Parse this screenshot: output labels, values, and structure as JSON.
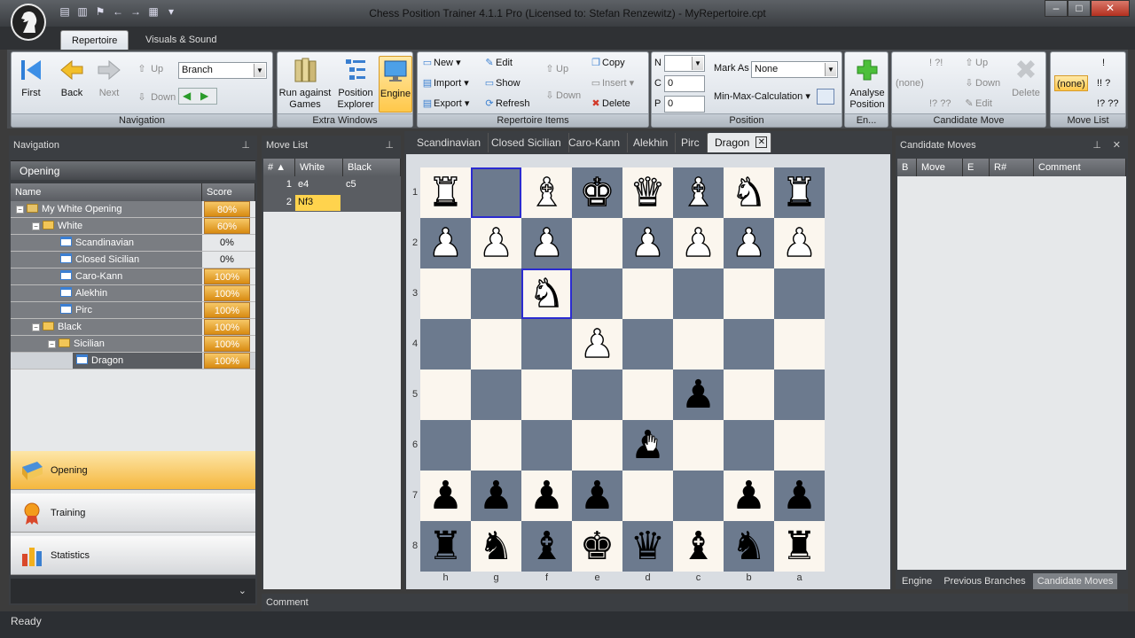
{
  "window": {
    "title": "Chess Position Trainer 4.1.1 Pro (Licensed to: Stefan Renzewitz) - MyRepertoire.cpt",
    "buttons": [
      "–",
      "□",
      "✕"
    ]
  },
  "ribbon_tabs": [
    "Repertoire",
    "Visuals & Sound"
  ],
  "ribbon": {
    "navigation": {
      "caption": "Navigation",
      "first": "First",
      "back": "Back",
      "next": "Next",
      "up": "Up",
      "down": "Down",
      "branch_value": "Branch"
    },
    "extra_windows": {
      "caption": "Extra Windows",
      "run_against_1": "Run against",
      "run_against_2": "Games",
      "position_1": "Position",
      "position_2": "Explorer",
      "engine": "Engine"
    },
    "repertoire_items": {
      "caption": "Repertoire Items",
      "new": "New",
      "import": "Import",
      "export": "Export",
      "edit": "Edit",
      "show": "Show",
      "refresh": "Refresh",
      "up": "Up",
      "down": "Down",
      "copy": "Copy",
      "insert": "Insert",
      "delete": "Delete"
    },
    "position": {
      "caption": "Position",
      "n_label": "N",
      "c_label": "C",
      "c_value": "0",
      "p_label": "P",
      "p_value": "0",
      "mark_as_label": "Mark As",
      "mark_as_value": "None",
      "minmax": "Min-Max-Calculation"
    },
    "engine_group": {
      "caption": "En...",
      "analyse_1": "Analyse",
      "analyse_2": "Position"
    },
    "candidate_move": {
      "caption": "Candidate Move",
      "none": "(none)",
      "up": "Up",
      "down": "Down",
      "edit": "Edit",
      "delete": "Delete",
      "marks_a": "! ?!",
      "marks_b": "!? ??"
    },
    "move_list": {
      "caption": "Move List",
      "none": "(none)",
      "marks_a": "!",
      "marks_b": "!! ?",
      "marks_c": "!? ??"
    }
  },
  "navigation_panel": {
    "title": "Navigation",
    "section": "Opening",
    "columns": [
      "Name",
      "Score"
    ],
    "rows": [
      {
        "name": "My White Opening",
        "score": "80%"
      },
      {
        "name": "White",
        "score": "60%"
      },
      {
        "name": "Scandinavian",
        "score": "0%"
      },
      {
        "name": "Closed Sicilian",
        "score": "0%"
      },
      {
        "name": "Caro-Kann",
        "score": "100%"
      },
      {
        "name": "Alekhin",
        "score": "100%"
      },
      {
        "name": "Pirc",
        "score": "100%"
      },
      {
        "name": "Black",
        "score": "100%"
      },
      {
        "name": "Sicilian",
        "score": "100%"
      },
      {
        "name": "Dragon",
        "score": "100%"
      }
    ],
    "buttons": [
      "Opening",
      "Training",
      "Statistics"
    ]
  },
  "move_list_panel": {
    "title": "Move List",
    "columns": [
      "#",
      "White",
      "Black"
    ],
    "moves": [
      {
        "n": "1",
        "white": "e4",
        "black": "c5"
      },
      {
        "n": "2",
        "white": "Nf3",
        "black": ""
      }
    ]
  },
  "board_tabs": [
    "Scandinavian",
    "Closed Sicilian",
    "Caro-Kann",
    "Alekhin",
    "Pirc",
    "Dragon"
  ],
  "board": {
    "ranks": [
      "1",
      "2",
      "3",
      "4",
      "5",
      "6",
      "7",
      "8"
    ],
    "files": [
      "h",
      "g",
      "f",
      "e",
      "d",
      "c",
      "b",
      "a"
    ],
    "rows": [
      [
        "wr",
        "",
        "wb",
        "wk",
        "wq",
        "wb",
        "wn",
        "wr"
      ],
      [
        "wp",
        "wp",
        "wp",
        "",
        "wp",
        "wp",
        "wp",
        "wp"
      ],
      [
        "",
        "",
        "wn",
        "",
        "",
        "",
        "",
        ""
      ],
      [
        "",
        "",
        "",
        "wp",
        "",
        "",
        "",
        ""
      ],
      [
        "",
        "",
        "",
        "",
        "",
        "bp",
        "",
        ""
      ],
      [
        "",
        "",
        "",
        "",
        "bp",
        "",
        "",
        ""
      ],
      [
        "bp",
        "bp",
        "bp",
        "bp",
        "",
        "",
        "bp",
        "bp"
      ],
      [
        "br",
        "bn",
        "bb",
        "bk",
        "bq",
        "bb",
        "bn",
        "br"
      ]
    ]
  },
  "candidate_panel": {
    "title": "Candidate Moves",
    "columns": [
      "B",
      "Move",
      "E",
      "R#",
      "Comment"
    ],
    "bottom_tabs": [
      "Engine",
      "Previous Branches",
      "Candidate Moves"
    ]
  },
  "comment_label": "Comment",
  "status": "Ready"
}
